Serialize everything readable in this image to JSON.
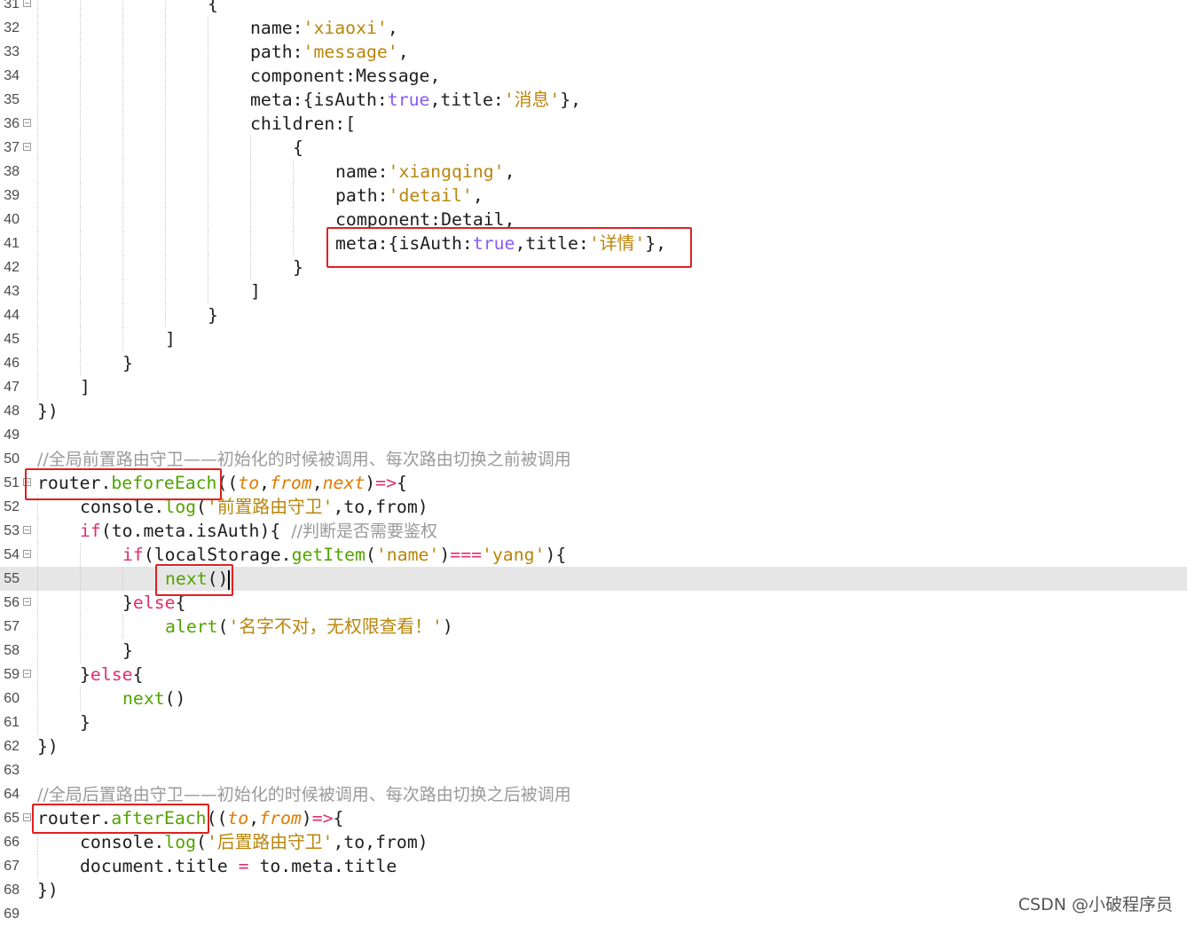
{
  "editor": {
    "lines": [
      {
        "num": "31",
        "fold": true,
        "indent": 4,
        "tokens": [
          [
            "p",
            "{"
          ]
        ]
      },
      {
        "num": "32",
        "indent": 5,
        "tokens": [
          [
            "n",
            "name:"
          ],
          [
            "s",
            "'xiaoxi'"
          ],
          [
            "p",
            ","
          ]
        ]
      },
      {
        "num": "33",
        "indent": 5,
        "tokens": [
          [
            "n",
            "path:"
          ],
          [
            "s",
            "'message'"
          ],
          [
            "p",
            ","
          ]
        ]
      },
      {
        "num": "34",
        "indent": 5,
        "tokens": [
          [
            "n",
            "component:Message,"
          ]
        ]
      },
      {
        "num": "35",
        "indent": 5,
        "tokens": [
          [
            "n",
            "meta:{isAuth:"
          ],
          [
            "b",
            "true"
          ],
          [
            "n",
            ",title:"
          ],
          [
            "s",
            "'消息'"
          ],
          [
            "p",
            "},"
          ]
        ]
      },
      {
        "num": "36",
        "fold": true,
        "indent": 5,
        "tokens": [
          [
            "n",
            "children:["
          ]
        ]
      },
      {
        "num": "37",
        "fold": true,
        "indent": 6,
        "tokens": [
          [
            "p",
            "{"
          ]
        ]
      },
      {
        "num": "38",
        "indent": 7,
        "tokens": [
          [
            "n",
            "name:"
          ],
          [
            "s",
            "'xiangqing'"
          ],
          [
            "p",
            ","
          ]
        ]
      },
      {
        "num": "39",
        "indent": 7,
        "tokens": [
          [
            "n",
            "path:"
          ],
          [
            "s",
            "'detail'"
          ],
          [
            "p",
            ","
          ]
        ]
      },
      {
        "num": "40",
        "indent": 7,
        "tokens": [
          [
            "n",
            "component:Detail,"
          ]
        ]
      },
      {
        "num": "41",
        "indent": 7,
        "tokens": [
          [
            "n",
            "meta:{isAuth:"
          ],
          [
            "b",
            "true"
          ],
          [
            "n",
            ",title:"
          ],
          [
            "s",
            "'详情'"
          ],
          [
            "p",
            "},"
          ]
        ]
      },
      {
        "num": "42",
        "indent": 6,
        "tokens": [
          [
            "p",
            "}"
          ]
        ]
      },
      {
        "num": "43",
        "indent": 5,
        "tokens": [
          [
            "p",
            "]"
          ]
        ]
      },
      {
        "num": "44",
        "indent": 4,
        "tokens": [
          [
            "p",
            "}"
          ]
        ]
      },
      {
        "num": "45",
        "indent": 3,
        "tokens": [
          [
            "p",
            "]"
          ]
        ]
      },
      {
        "num": "46",
        "indent": 2,
        "tokens": [
          [
            "p",
            "}"
          ]
        ]
      },
      {
        "num": "47",
        "indent": 1,
        "tokens": [
          [
            "p",
            "]"
          ]
        ]
      },
      {
        "num": "48",
        "indent": 0,
        "tokens": [
          [
            "p",
            "})"
          ]
        ]
      },
      {
        "num": "49",
        "indent": 0,
        "tokens": []
      },
      {
        "num": "50",
        "indent": 0,
        "tokens": [
          [
            "c",
            "//全局前置路由守卫——初始化的时候被调用、每次路由切换之前被调用"
          ]
        ]
      },
      {
        "num": "51",
        "fold": true,
        "indent": 0,
        "tokens": [
          [
            "n",
            "router."
          ],
          [
            "f",
            "beforeEach"
          ],
          [
            "p",
            "(("
          ],
          [
            "a",
            "to"
          ],
          [
            "p",
            ","
          ],
          [
            "a",
            "from"
          ],
          [
            "p",
            ","
          ],
          [
            "a",
            "next"
          ],
          [
            "p",
            ")"
          ],
          [
            "o",
            "=>"
          ],
          [
            "p",
            "{"
          ]
        ]
      },
      {
        "num": "52",
        "indent": 1,
        "tokens": [
          [
            "n",
            "console."
          ],
          [
            "f",
            "log"
          ],
          [
            "p",
            "("
          ],
          [
            "s",
            "'前置路由守卫'"
          ],
          [
            "n",
            ",to,from)"
          ]
        ]
      },
      {
        "num": "53",
        "fold": true,
        "indent": 1,
        "tokens": [
          [
            "k",
            "if"
          ],
          [
            "n",
            "(to.meta.isAuth){ "
          ],
          [
            "c",
            "//判断是否需要鉴权"
          ]
        ]
      },
      {
        "num": "54",
        "fold": true,
        "indent": 2,
        "tokens": [
          [
            "k",
            "if"
          ],
          [
            "n",
            "(localStorage."
          ],
          [
            "f",
            "getItem"
          ],
          [
            "p",
            "("
          ],
          [
            "s",
            "'name'"
          ],
          [
            "p",
            ")"
          ],
          [
            "o",
            "==="
          ],
          [
            "s",
            "'yang'"
          ],
          [
            "p",
            "){"
          ]
        ]
      },
      {
        "num": "55",
        "indent": 3,
        "current": true,
        "tokens": [
          [
            "f",
            "next"
          ],
          [
            "p",
            "()"
          ]
        ]
      },
      {
        "num": "56",
        "fold": true,
        "indent": 2,
        "tokens": [
          [
            "p",
            "}"
          ],
          [
            "k",
            "else"
          ],
          [
            "p",
            "{"
          ]
        ]
      },
      {
        "num": "57",
        "indent": 3,
        "tokens": [
          [
            "f",
            "alert"
          ],
          [
            "p",
            "("
          ],
          [
            "s",
            "'名字不对，无权限查看！'"
          ],
          [
            "p",
            ")"
          ]
        ]
      },
      {
        "num": "58",
        "indent": 2,
        "tokens": [
          [
            "p",
            "}"
          ]
        ]
      },
      {
        "num": "59",
        "fold": true,
        "indent": 1,
        "tokens": [
          [
            "p",
            "}"
          ],
          [
            "k",
            "else"
          ],
          [
            "p",
            "{"
          ]
        ]
      },
      {
        "num": "60",
        "indent": 2,
        "tokens": [
          [
            "f",
            "next"
          ],
          [
            "p",
            "()"
          ]
        ]
      },
      {
        "num": "61",
        "indent": 1,
        "tokens": [
          [
            "p",
            "}"
          ]
        ]
      },
      {
        "num": "62",
        "indent": 0,
        "tokens": [
          [
            "p",
            "})"
          ]
        ]
      },
      {
        "num": "63",
        "indent": 0,
        "tokens": []
      },
      {
        "num": "64",
        "indent": 0,
        "tokens": [
          [
            "c",
            "//全局后置路由守卫——初始化的时候被调用、每次路由切换之后被调用"
          ]
        ]
      },
      {
        "num": "65",
        "fold": true,
        "indent": 0,
        "tokens": [
          [
            "n",
            "router."
          ],
          [
            "f",
            "afterEach"
          ],
          [
            "p",
            "(("
          ],
          [
            "a",
            "to"
          ],
          [
            "p",
            ","
          ],
          [
            "a",
            "from"
          ],
          [
            "p",
            ")"
          ],
          [
            "o",
            "=>"
          ],
          [
            "p",
            "{"
          ]
        ]
      },
      {
        "num": "66",
        "indent": 1,
        "tokens": [
          [
            "n",
            "console."
          ],
          [
            "f",
            "log"
          ],
          [
            "p",
            "("
          ],
          [
            "s",
            "'后置路由守卫'"
          ],
          [
            "n",
            ",to,from)"
          ]
        ]
      },
      {
        "num": "67",
        "indent": 1,
        "tokens": [
          [
            "n",
            "document.title "
          ],
          [
            "o",
            "="
          ],
          [
            "n",
            " to.meta.title"
          ]
        ]
      },
      {
        "num": "68",
        "indent": 0,
        "tokens": [
          [
            "p",
            "})"
          ]
        ]
      },
      {
        "num": "69",
        "indent": 0,
        "tokens": []
      }
    ]
  },
  "watermark": "CSDN @小破程序员",
  "colors": {
    "highlight_box": "#e02020",
    "string": "#b8860b",
    "keyword": "#e0306a",
    "boolean": "#8a5cf5",
    "function": "#52a300",
    "param": "#e07b00",
    "comment": "#9a9a9a",
    "current_line": "#e6e6e6"
  }
}
